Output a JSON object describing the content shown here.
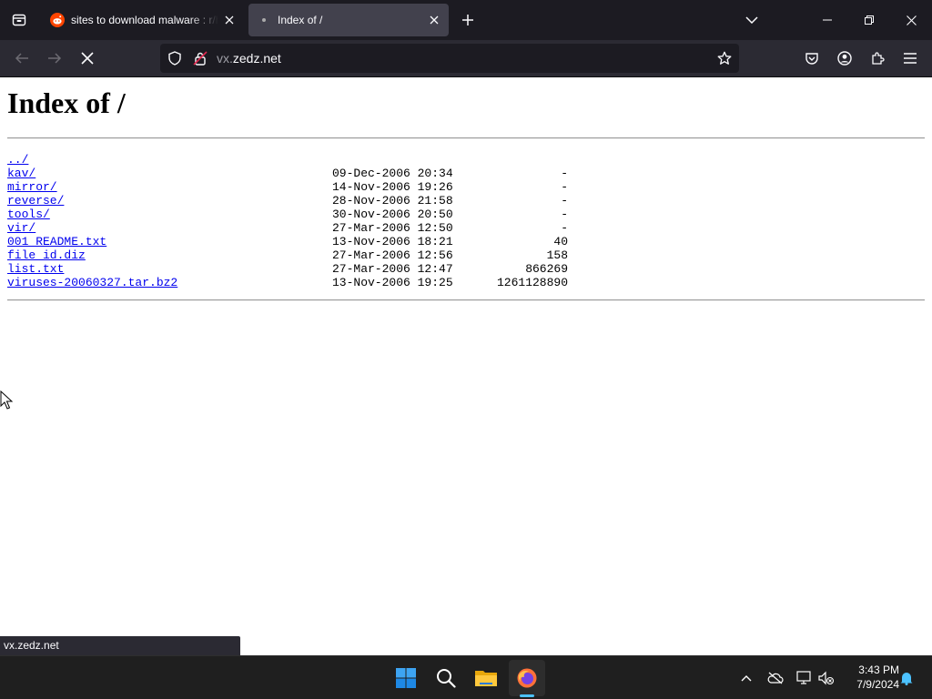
{
  "browser": {
    "tabs": [
      {
        "title": "sites to download malware : r/h",
        "favicon": "reddit-icon",
        "active": false
      },
      {
        "title": "Index of /",
        "favicon": "loading-dot",
        "active": true
      }
    ],
    "url": {
      "subdomain": "vx.",
      "domain": "zedz.net"
    },
    "status_url": "vx.zedz.net"
  },
  "page": {
    "heading": "Index of /",
    "parent_link": "../",
    "entries": [
      {
        "name": "kav/",
        "date": "09-Dec-2006 20:34",
        "size": "-"
      },
      {
        "name": "mirror/",
        "date": "14-Nov-2006 19:26",
        "size": "-"
      },
      {
        "name": "reverse/",
        "date": "28-Nov-2006 21:58",
        "size": "-"
      },
      {
        "name": "tools/",
        "date": "30-Nov-2006 20:50",
        "size": "-"
      },
      {
        "name": "vir/",
        "date": "27-Mar-2006 12:50",
        "size": "-"
      },
      {
        "name": "001_README.txt",
        "date": "13-Nov-2006 18:21",
        "size": "40"
      },
      {
        "name": "file_id.diz",
        "date": "27-Mar-2006 12:56",
        "size": "158"
      },
      {
        "name": "list.txt",
        "date": "27-Mar-2006 12:47",
        "size": "866269"
      },
      {
        "name": "viruses-20060327.tar.bz2",
        "date": "13-Nov-2006 19:25",
        "size": "1261128890"
      }
    ]
  },
  "taskbar": {
    "apps": [
      "start-icon",
      "search-icon",
      "file-explorer-icon",
      "firefox-icon"
    ],
    "active_app": "firefox-icon",
    "time": "3:43 PM",
    "date": "7/9/2024"
  },
  "colors": {
    "link": "#0000ee",
    "accent": "#4cc2ff",
    "tab_bar": "#1c1b22",
    "toolbar": "#2b2a33"
  }
}
